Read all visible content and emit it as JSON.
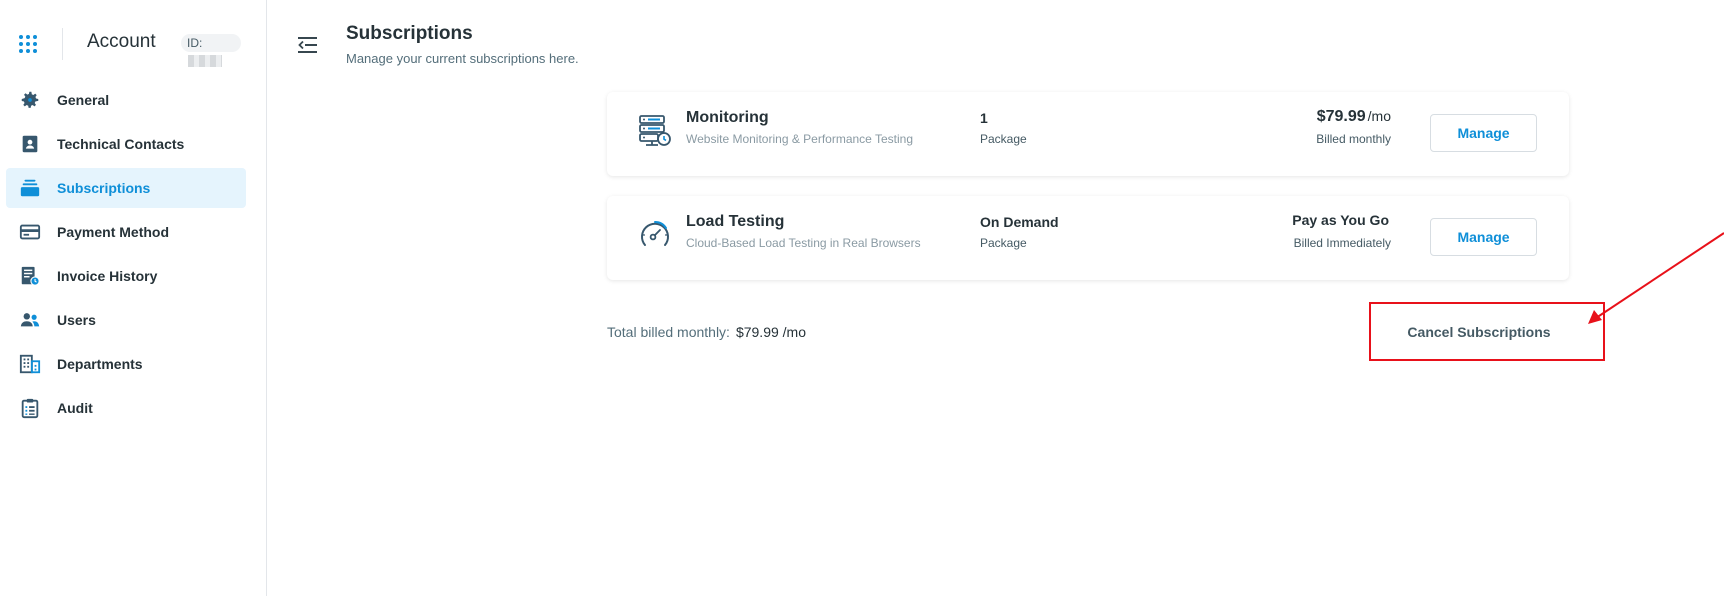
{
  "sidebar": {
    "title": "Account",
    "id_label": "ID:",
    "items": [
      {
        "label": "General",
        "icon": "gear-icon",
        "active": false
      },
      {
        "label": "Technical Contacts",
        "icon": "contact-card-icon",
        "active": false
      },
      {
        "label": "Subscriptions",
        "icon": "layers-icon",
        "active": true
      },
      {
        "label": "Payment Method",
        "icon": "credit-card-icon",
        "active": false
      },
      {
        "label": "Invoice History",
        "icon": "invoice-clock-icon",
        "active": false
      },
      {
        "label": "Users",
        "icon": "users-icon",
        "active": false
      },
      {
        "label": "Departments",
        "icon": "building-icon",
        "active": false
      },
      {
        "label": "Audit",
        "icon": "clipboard-icon",
        "active": false
      }
    ]
  },
  "header": {
    "title": "Subscriptions",
    "subtitle": "Manage your current subscriptions here."
  },
  "subscriptions": [
    {
      "name": "Monitoring",
      "description": "Website Monitoring & Performance Testing",
      "quantity": "1",
      "quantity_label": "Package",
      "price": "$79.99",
      "price_unit": "/mo",
      "billing": "Billed monthly",
      "button": "Manage",
      "icon": "server-monitor-icon"
    },
    {
      "name": "Load Testing",
      "description": "Cloud-Based Load Testing in Real Browsers",
      "quantity": "On Demand",
      "quantity_label": "Package",
      "price": "Pay as You Go",
      "price_unit": "",
      "billing": "Billed Immediately",
      "button": "Manage",
      "icon": "speedometer-icon"
    }
  ],
  "total": {
    "label": "Total billed monthly:",
    "amount": "$79.99 /mo"
  },
  "cancel_button": "Cancel Subscriptions",
  "colors": {
    "accent": "#0f8fd8",
    "active_bg": "#e5f4fd",
    "annotation": "#e8111a"
  }
}
